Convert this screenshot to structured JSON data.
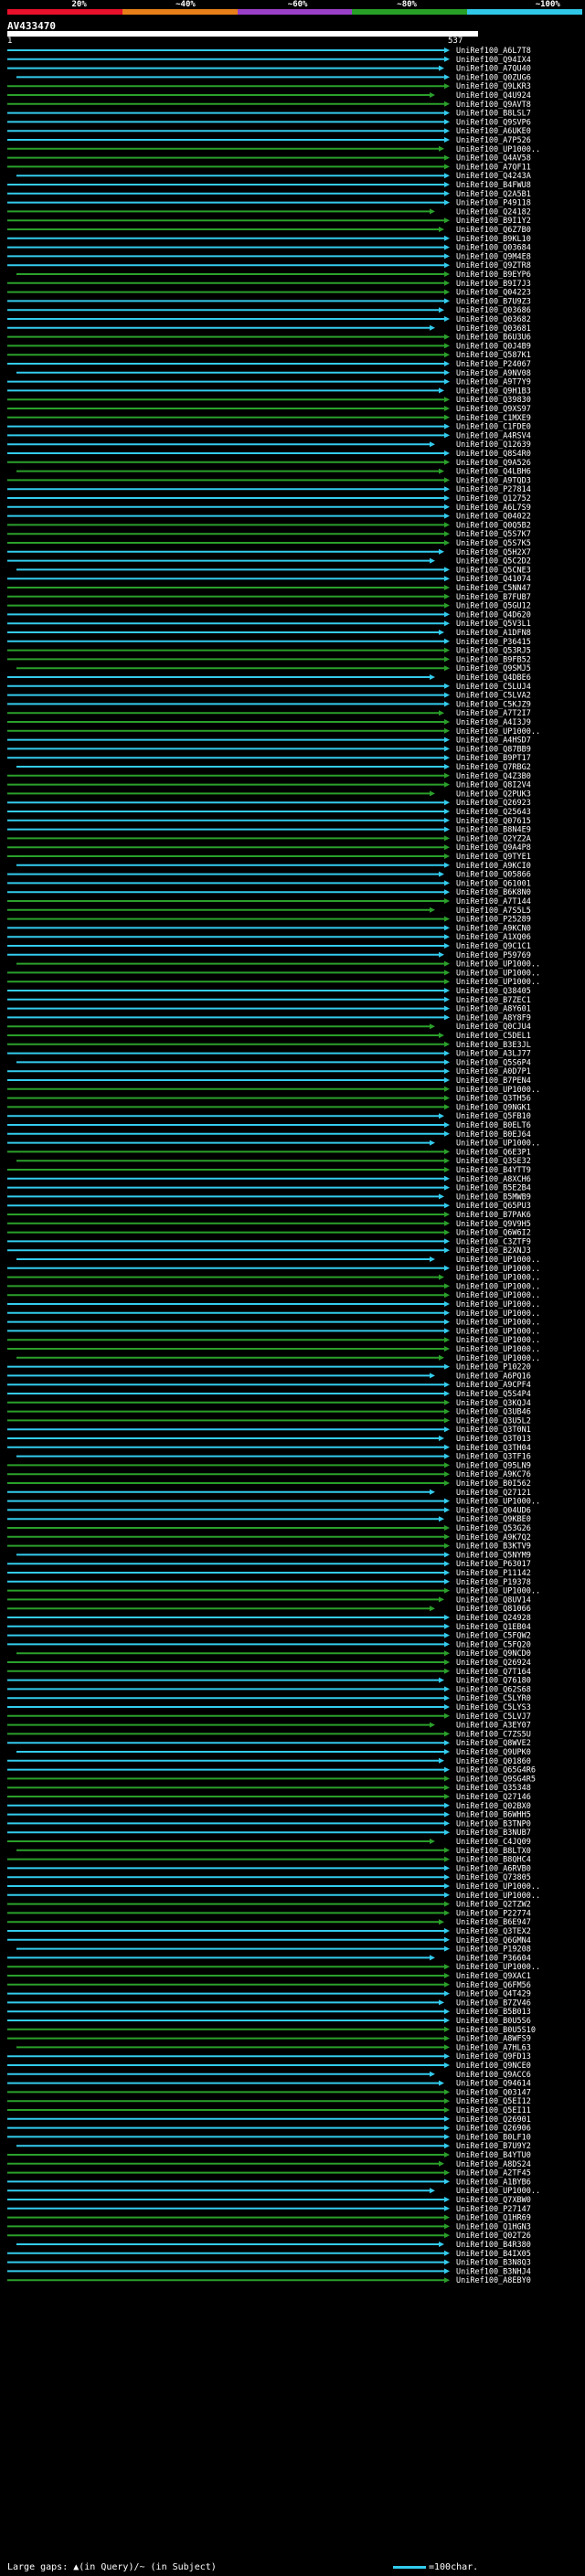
{
  "query": {
    "id": "AV433470",
    "start": "1",
    "end": "537"
  },
  "scale": {
    "labels": [
      "20%",
      "~40%",
      "~60%",
      "~80%",
      "~100%"
    ],
    "colors": [
      "#e8102a",
      "#e8801a",
      "#9a40c8",
      "#28a028",
      "#30c8e8"
    ]
  },
  "colors": {
    "green": "#2aa02a",
    "cyan": "#33ccee",
    "white": "#ffffff"
  },
  "hits": [
    "UniRef100_A6L7T8",
    "UniRef100_Q94IX4",
    "UniRef100_A7QU40",
    "UniRef100_Q0ZUG6",
    "UniRef100_Q9LKR3",
    "UniRef100_Q4U924",
    "UniRef100_Q9AVT8",
    "UniRef100_B8LSL7",
    "UniRef100_Q9SVP6",
    "UniRef100_A6UKE0",
    "UniRef100_A7P526",
    "UniRef100_UP1000..",
    "UniRef100_Q4AV58",
    "UniRef100_A7QF11",
    "UniRef100_Q4243A",
    "UniRef100_B4FWU8",
    "UniRef100_Q2A5B1",
    "UniRef100_P49118",
    "UniRef100_Q24182",
    "UniRef100_B9I1Y2",
    "UniRef100_Q6Z7B0",
    "UniRef100_B9KL10",
    "UniRef100_Q03684",
    "UniRef100_Q9M4E8",
    "UniRef100_Q9ZTR8",
    "UniRef100_B9EYP6",
    "UniRef100_B9I7J3",
    "UniRef100_Q04223",
    "UniRef100_B7U9Z3",
    "UniRef100_Q03686",
    "UniRef100_Q03682",
    "UniRef100_Q03681",
    "UniRef100_B6U3U6",
    "UniRef100_Q0J4B9",
    "UniRef100_Q587K1",
    "UniRef100_P24067",
    "UniRef100_A9NV08",
    "UniRef100_A9T7Y9",
    "UniRef100_Q9H1B3",
    "UniRef100_Q39830",
    "UniRef100_Q9XS97",
    "UniRef100_C1MXE9",
    "UniRef100_C1FDE0",
    "UniRef100_A4RSV4",
    "UniRef100_Q12639",
    "UniRef100_Q8S4R0",
    "UniRef100_Q9A526",
    "UniRef100_Q4LBH6",
    "UniRef100_A9TQD3",
    "UniRef100_P27814",
    "UniRef100_Q12752",
    "UniRef100_A6L7S9",
    "UniRef100_Q04022",
    "UniRef100_Q0Q5B2",
    "UniRef100_Q5S7K7",
    "UniRef100_Q5S7K5",
    "UniRef100_Q5H2X7",
    "UniRef100_Q5C2D2",
    "UniRef100_Q5CNE3",
    "UniRef100_Q41074",
    "UniRef100_C5NN47",
    "UniRef100_B7FUB7",
    "UniRef100_Q5GU12",
    "UniRef100_Q4D620",
    "UniRef100_Q5V3L1",
    "UniRef100_A1DFN8",
    "UniRef100_P36415",
    "UniRef100_Q53RJ5",
    "UniRef100_B9FB52",
    "UniRef100_Q9SMJ5",
    "UniRef100_Q4DBE6",
    "UniRef100_C5LUJ4",
    "UniRef100_C5LVA2",
    "UniRef100_C5KJZ9",
    "UniRef100_A7T2I7",
    "UniRef100_A4I3J9",
    "UniRef100_UP1000..",
    "UniRef100_A4HSD7",
    "UniRef100_Q87BB9",
    "UniRef100_B9PT17",
    "UniRef100_Q7RBG2",
    "UniRef100_Q4Z3B0",
    "UniRef100_Q8I2V4",
    "UniRef100_Q2PUK3",
    "UniRef100_Q26923",
    "UniRef100_Q25643",
    "UniRef100_Q07615",
    "UniRef100_B8N4E9",
    "UniRef100_Q2YZ2A",
    "UniRef100_Q9A4P8",
    "UniRef100_Q9TYE1",
    "UniRef100_A9KCI0",
    "UniRef100_Q05866",
    "UniRef100_Q61001",
    "UniRef100_B6K8N0",
    "UniRef100_A7T144",
    "UniRef100_A7S5L5",
    "UniRef100_P25289",
    "UniRef100_A9KCN0",
    "UniRef100_A1XQ06",
    "UniRef100_Q9C1C1",
    "UniRef100_P59769",
    "UniRef100_UP1000..",
    "UniRef100_UP1000..",
    "UniRef100_UP1000..",
    "UniRef100_Q38405",
    "UniRef100_B7ZEC1",
    "UniRef100_A8Y601",
    "UniRef100_A8Y8F9",
    "UniRef100_Q0CJU4",
    "UniRef100_C5DEL1",
    "UniRef100_B3E3JL",
    "UniRef100_A3LJ77",
    "UniRef100_Q5S6P4",
    "UniRef100_A0D7P1",
    "UniRef100_B7PEN4",
    "UniRef100_UP1000..",
    "UniRef100_Q3TH56",
    "UniRef100_Q9NGK1",
    "UniRef100_Q5FB10",
    "UniRef100_B0ELT6",
    "UniRef100_B0EJ64",
    "UniRef100_UP1000..",
    "UniRef100_Q6E3P1",
    "UniRef100_Q3SE32",
    "UniRef100_B4YTT9",
    "UniRef100_A8XCH6",
    "UniRef100_B5E2B4",
    "UniRef100_B5MWB9",
    "UniRef100_Q65PU3",
    "UniRef100_B7PAK6",
    "UniRef100_Q9V9H5",
    "UniRef100_Q6W6I2",
    "UniRef100_C3ZTF9",
    "UniRef100_B2XNJ3",
    "UniRef100_UP1000..",
    "UniRef100_UP1000..",
    "UniRef100_UP1000..",
    "UniRef100_UP1000..",
    "UniRef100_UP1000..",
    "UniRef100_UP1000..",
    "UniRef100_UP1000..",
    "UniRef100_UP1000..",
    "UniRef100_UP1000..",
    "UniRef100_UP1000..",
    "UniRef100_UP1000..",
    "UniRef100_UP1000..",
    "UniRef100_P10220",
    "UniRef100_A6PQ16",
    "UniRef100_A9CPF4",
    "UniRef100_Q5S4P4",
    "UniRef100_Q3KQJ4",
    "UniRef100_Q3UB46",
    "UniRef100_Q3U5L2",
    "UniRef100_Q3T0N1",
    "UniRef100_Q3T013",
    "UniRef100_Q3TH04",
    "UniRef100_Q3TF16",
    "UniRef100_Q95LN9",
    "UniRef100_A9KC76",
    "UniRef100_B0I562",
    "UniRef100_Q27121",
    "UniRef100_UP1000..",
    "UniRef100_Q04UD6",
    "UniRef100_Q9KBE0",
    "UniRef100_Q53G26",
    "UniRef100_A9K7Q2",
    "UniRef100_B3KTV9",
    "UniRef100_Q5NYM9",
    "UniRef100_P63017",
    "UniRef100_P11142",
    "UniRef100_P19378",
    "UniRef100_UP1000..",
    "UniRef100_Q8UV14",
    "UniRef100_Q81066",
    "UniRef100_Q24928",
    "UniRef100_Q1EB04",
    "UniRef100_C5FQW2",
    "UniRef100_C5FQ20",
    "UniRef100_Q9NCD0",
    "UniRef100_Q26924",
    "UniRef100_Q7T164",
    "UniRef100_Q76180",
    "UniRef100_Q62S68",
    "UniRef100_C5LYR0",
    "UniRef100_C5LYS3",
    "UniRef100_C5LVJ7",
    "UniRef100_A3EY07",
    "UniRef100_C7ZS5U",
    "UniRef100_Q8WVE2",
    "UniRef100_Q9UPK0",
    "UniRef100_Q01860",
    "UniRef100_Q65G4R6",
    "UniRef100_Q9SG4R5",
    "UniRef100_Q35348",
    "UniRef100_Q27146",
    "UniRef100_Q02BX0",
    "UniRef100_B6WHH5",
    "UniRef100_B3TNP0",
    "UniRef100_B3NUB7",
    "UniRef100_C4JQ09",
    "UniRef100_B8LTX0",
    "UniRef100_B8QHC4",
    "UniRef100_A6RVB0",
    "UniRef100_Q73805",
    "UniRef100_UP1000..",
    "UniRef100_UP1000..",
    "UniRef100_Q2TZW2",
    "UniRef100_P22774",
    "UniRef100_B6E947",
    "UniRef100_Q3TEX2",
    "UniRef100_Q6GMN4",
    "UniRef100_P19208",
    "UniRef100_P36604",
    "UniRef100_UP1000..",
    "UniRef100_Q9XAC1",
    "UniRef100_Q6FM56",
    "UniRef100_Q4T429",
    "UniRef100_B7ZV46",
    "UniRef100_B5B013",
    "UniRef100_B0U5S6",
    "UniRef100_B0U5S10",
    "UniRef100_A8WFS9",
    "UniRef100_A7HL63",
    "UniRef100_Q9FD13",
    "UniRef100_Q9NCE0",
    "UniRef100_Q9ACC6",
    "UniRef100_Q94614",
    "UniRef100_Q03147",
    "UniRef100_Q5EI12",
    "UniRef100_Q5EI11",
    "UniRef100_Q26901",
    "UniRef100_Q26906",
    "UniRef100_B0LF10",
    "UniRef100_B7U9Y2",
    "UniRef100_B4YTU0",
    "UniRef100_A8DS24",
    "UniRef100_A2TF45",
    "UniRef100_A1BYB6",
    "UniRef100_UP1000..",
    "UniRef100_Q7XBW0",
    "UniRef100_P27147",
    "UniRef100_Q1HR69",
    "UniRef100_Q1HGN3",
    "UniRef100_Q02T26",
    "UniRef100_B4R380",
    "UniRef100_B4IX05",
    "UniRef100_B3N8Q3",
    "UniRef100_B3NHJ4",
    "UniRef100_A8EBY0"
  ]
}
